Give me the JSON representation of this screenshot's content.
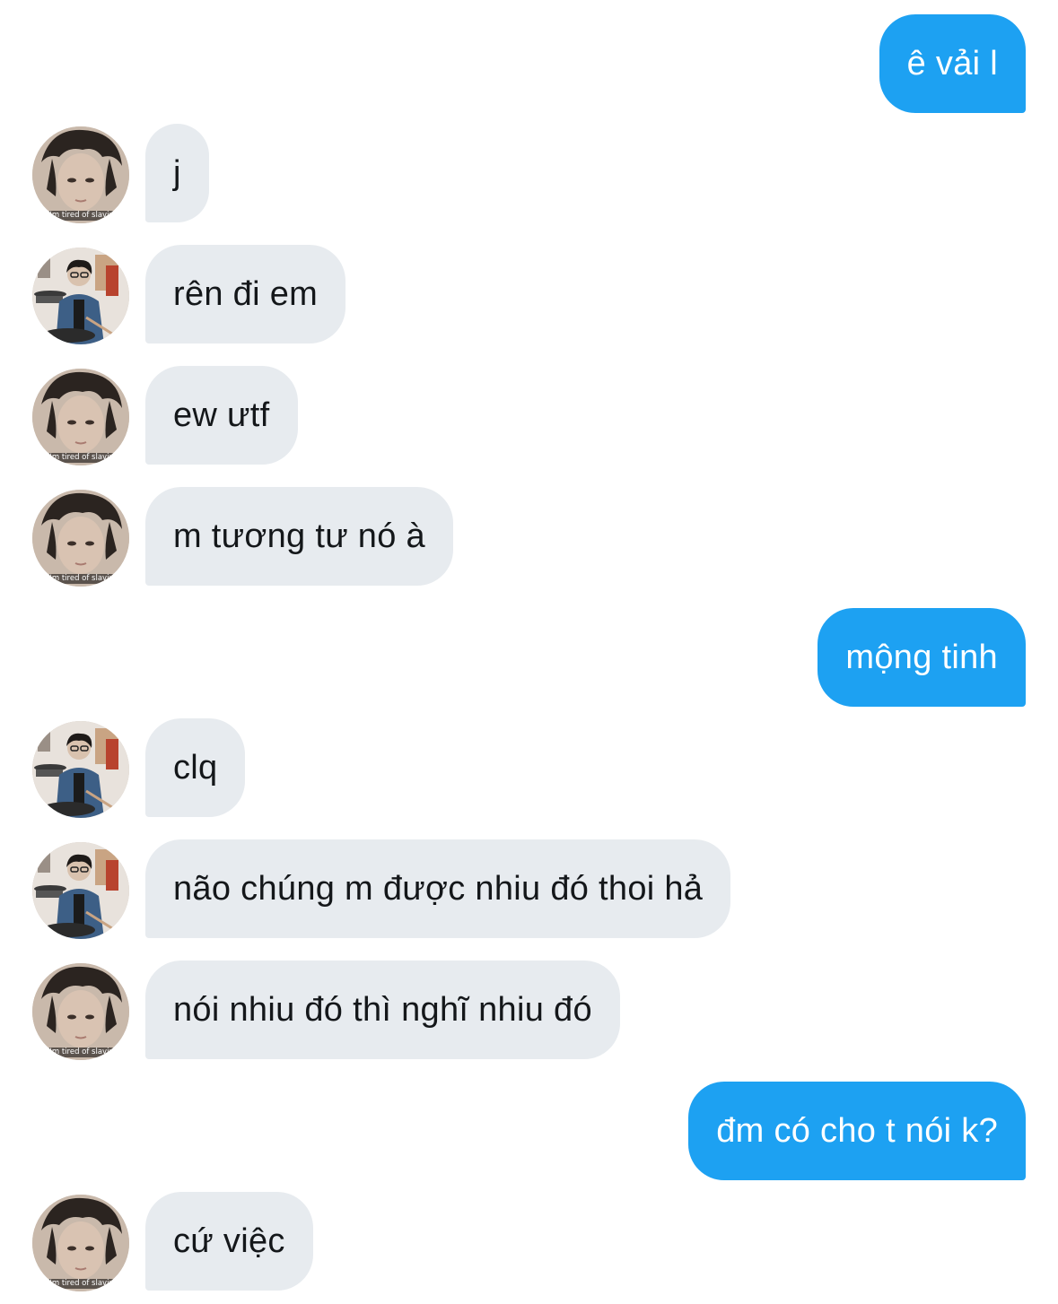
{
  "colors": {
    "outgoing_bubble": "#1da1f2",
    "incoming_bubble": "#e7ebef",
    "incoming_text": "#14171a",
    "outgoing_text": "#ffffff"
  },
  "avatars": {
    "a": {
      "icon": "portrait-photo-closeup",
      "caption": "i'm tired of slavin"
    },
    "b": {
      "icon": "portrait-photo-drummer"
    }
  },
  "messages": [
    {
      "direction": "out",
      "text": "ê vải l"
    },
    {
      "direction": "in",
      "avatar": "a",
      "text": "j"
    },
    {
      "direction": "in",
      "avatar": "b",
      "text": "rên đi em"
    },
    {
      "direction": "in",
      "avatar": "a",
      "text": "ew ưtf"
    },
    {
      "direction": "in",
      "avatar": "a",
      "text": "m tương tư nó à"
    },
    {
      "direction": "out",
      "text": "mộng tinh"
    },
    {
      "direction": "in",
      "avatar": "b",
      "text": "clq"
    },
    {
      "direction": "in",
      "avatar": "b",
      "text": "não chúng m được nhiu đó thoi hả"
    },
    {
      "direction": "in",
      "avatar": "a",
      "text": "nói nhiu đó thì nghĩ nhiu đó"
    },
    {
      "direction": "out",
      "text": "đm có cho t nói k?"
    },
    {
      "direction": "in",
      "avatar": "a",
      "text": "cứ việc"
    }
  ]
}
